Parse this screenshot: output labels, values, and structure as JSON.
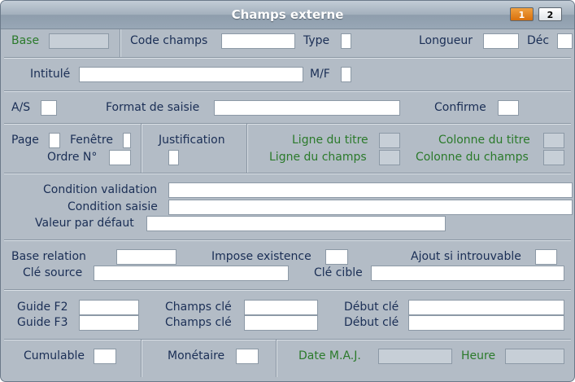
{
  "window": {
    "title": "Champs externe",
    "tabs": [
      "1",
      "2"
    ]
  },
  "labels": {
    "base": "Base",
    "code_champs": "Code champs",
    "type": "Type",
    "longueur": "Longueur",
    "dec": "Déc",
    "intitule": "Intitulé",
    "mf": "M/F",
    "as": "A/S",
    "format_saisie": "Format de saisie",
    "confirme": "Confirme",
    "page": "Page",
    "fenetre": "Fenêtre",
    "ordre_no": "Ordre N°",
    "justification": "Justification",
    "ligne_titre": "Ligne du titre",
    "ligne_champs": "Ligne du champs",
    "colonne_titre": "Colonne du titre",
    "colonne_champs": "Colonne du champs",
    "condition_validation": "Condition validation",
    "condition_saisie": "Condition saisie",
    "valeur_defaut": "Valeur par défaut",
    "base_relation": "Base relation",
    "impose_existence": "Impose existence",
    "ajout_introuvable": "Ajout si introuvable",
    "cle_source": "Clé source",
    "cle_cible": "Clé cible",
    "guide_f2": "Guide F2",
    "guide_f3": "Guide F3",
    "champs_cle_1": "Champs clé",
    "champs_cle_2": "Champs clé",
    "debut_cle_1": "Début clé",
    "debut_cle_2": "Début clé",
    "cumulable": "Cumulable",
    "monetaire": "Monétaire",
    "date_maj": "Date M.A.J.",
    "heure": "Heure"
  },
  "colors": {
    "background": "#b3bcc6",
    "label": "#1a2e55",
    "label_readonly": "#2b7a2b",
    "tab_active": "#e07d16"
  }
}
